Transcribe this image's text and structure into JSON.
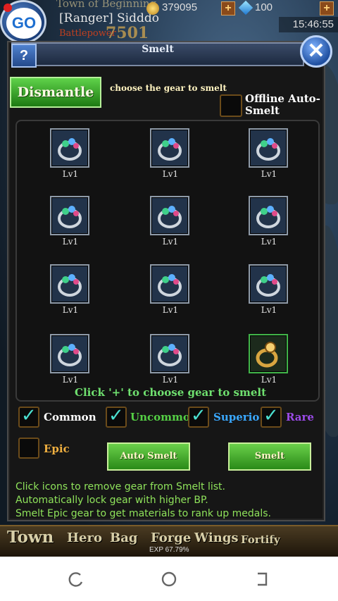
{
  "status": {
    "location": "Town of Beginning",
    "player": "[Ranger] Sidddo",
    "bp_label": "Battlepower",
    "bp_value": "7501",
    "gold": "379095",
    "gems": "100",
    "time": "15:46:55"
  },
  "panel": {
    "title": "Smelt",
    "help": "?",
    "close": "✕",
    "dismantle_label": "Dismantle",
    "choose_label": "choose the gear to smelt",
    "offline_label": "Offline Auto-Smelt",
    "offline_checked": false
  },
  "gear": [
    {
      "level": "Lv1",
      "rarity": "common"
    },
    {
      "level": "Lv1",
      "rarity": "common"
    },
    {
      "level": "Lv1",
      "rarity": "common"
    },
    {
      "level": "Lv1",
      "rarity": "common"
    },
    {
      "level": "Lv1",
      "rarity": "common"
    },
    {
      "level": "Lv1",
      "rarity": "common"
    },
    {
      "level": "Lv1",
      "rarity": "common"
    },
    {
      "level": "Lv1",
      "rarity": "common"
    },
    {
      "level": "Lv1",
      "rarity": "common"
    },
    {
      "level": "Lv1",
      "rarity": "common"
    },
    {
      "level": "Lv1",
      "rarity": "common"
    },
    {
      "level": "Lv1",
      "rarity": "epic"
    }
  ],
  "hint": "Click '+' to choose gear to smelt",
  "filters": [
    {
      "label": "Common",
      "color": "#ffffff",
      "checked": true
    },
    {
      "label": "Uncommon",
      "color": "#55d045",
      "checked": true
    },
    {
      "label": "Superior",
      "color": "#3aa8ff",
      "checked": true
    },
    {
      "label": "Rare",
      "color": "#9b4be8",
      "checked": true
    },
    {
      "label": "Epic",
      "color": "#f0b040",
      "checked": false
    }
  ],
  "buttons": {
    "auto_smelt": "Auto Smelt",
    "smelt": "Smelt"
  },
  "tips": [
    "Click icons to remove gear from Smelt list.",
    "Automatically lock gear with higher BP.",
    "Smelt Epic gear to get materials to rank up medals."
  ],
  "tabs": {
    "town": "Town",
    "hero": "Hero",
    "bag": "Bag",
    "forge": "Forge",
    "wings": "Wings",
    "fortify": "Fortify",
    "exp": "EXP 67.79%"
  },
  "nav_icons": [
    "recent-apps-icon",
    "home-icon",
    "back-icon"
  ]
}
